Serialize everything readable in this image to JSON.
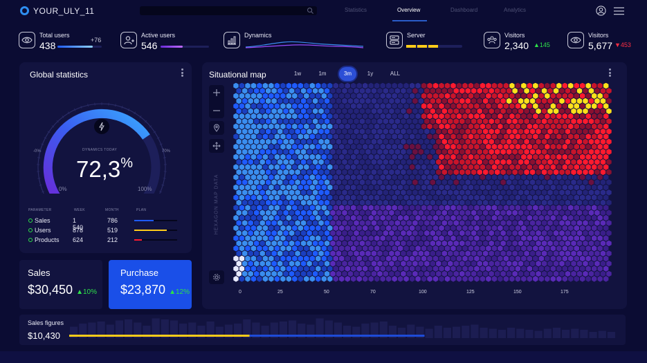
{
  "app": {
    "title": "YOUR_ULY_11"
  },
  "nav": {
    "tabs": [
      {
        "label": "Statistics",
        "active": false
      },
      {
        "label": "Overview",
        "active": true
      },
      {
        "label": "Dashboard",
        "active": false
      },
      {
        "label": "Analytics",
        "active": false
      }
    ],
    "icons": [
      "search-icon",
      "user-icon",
      "menu-icon"
    ]
  },
  "stats": {
    "total_users": {
      "label": "Total users",
      "value": "438",
      "delta": "+76",
      "icon": "eye-icon",
      "progress": 0.8
    },
    "active_users": {
      "label": "Active users",
      "value": "546",
      "icon": "user-add-icon",
      "progress": 0.46
    },
    "dynamics": {
      "label": "Dynamics",
      "icon": "chart-icon"
    },
    "server": {
      "label": "Server",
      "icon": "server-icon",
      "progress": 0.55,
      "segments": 3
    },
    "visitors_up": {
      "label": "Visitors",
      "value": "2,340",
      "delta": "145",
      "direction": "up",
      "icon": "group-icon"
    },
    "visitors_down": {
      "label": "Visitors",
      "value": "5,677",
      "delta": "453",
      "direction": "down",
      "icon": "eye-icon"
    }
  },
  "global_statistics": {
    "title": "Global statistics",
    "dynamics_label": "DYNAMICS TODAY",
    "value": "72,3",
    "unit": "%",
    "gauge_fraction": 0.723,
    "left_tick": "-0%",
    "right_tick": "70%",
    "min_label": "0%",
    "max_label": "100%",
    "icon": "lightning-icon",
    "table": {
      "headers": [
        "PARAMETER",
        "WEEK",
        "MONTH",
        "PLAN"
      ],
      "rows": [
        {
          "name": "Sales",
          "week": "1 540",
          "month": "786",
          "plan": 0.45,
          "color": "#1e5bff"
        },
        {
          "name": "Users",
          "week": "878",
          "month": "519",
          "plan": 0.75,
          "color": "#ffcc1a"
        },
        {
          "name": "Products",
          "week": "624",
          "month": "212",
          "plan": 0.18,
          "color": "#ff1a2e"
        }
      ]
    }
  },
  "sales_card": {
    "label": "Sales",
    "value": "$30,450",
    "delta": "10%"
  },
  "purchase_card": {
    "label": "Purchase",
    "value": "$23,870",
    "delta": "12%"
  },
  "map": {
    "title": "Situational map",
    "time_buttons": [
      "1w",
      "1m",
      "3m",
      "1y",
      "ALL"
    ],
    "active_time": "3m",
    "vertical_label": "HEXAGON MAP DATA",
    "x_ticks": [
      "0",
      "25",
      "50",
      "70",
      "100",
      "125",
      "150",
      "175"
    ],
    "controls": [
      "zoom-in-icon",
      "zoom-out-icon",
      "pin-icon",
      "move-icon",
      "settings-icon"
    ]
  },
  "sales_figures": {
    "label": "Sales figures",
    "value": "$10,430",
    "bars": [
      0.55,
      0.7,
      0.75,
      0.8,
      0.65,
      0.85,
      0.9,
      0.75,
      0.6,
      0.95,
      0.9,
      0.85,
      0.7,
      0.75,
      0.6,
      0.8,
      0.55,
      0.65,
      0.7,
      0.9,
      0.75,
      0.6,
      0.75,
      0.8,
      0.85,
      0.7,
      0.65,
      0.95,
      0.85,
      0.75,
      0.6,
      0.55,
      0.7,
      0.75,
      0.8,
      0.6,
      0.5,
      0.65,
      0.55,
      0.45,
      0.6,
      0.5,
      0.55,
      0.6,
      0.65,
      0.5,
      0.45,
      0.4,
      0.5,
      0.45,
      0.4,
      0.35,
      0.45,
      0.5,
      0.4,
      0.45,
      0.4,
      0.3,
      0.35,
      0.3
    ],
    "yellow_fraction": 0.33,
    "blue_fraction": 0.65
  },
  "colors": {
    "accent_blue": "#2e8ef0",
    "purchase_bg": "#1a4fe8",
    "positive": "#2ee04a",
    "negative": "#ff2e43"
  }
}
